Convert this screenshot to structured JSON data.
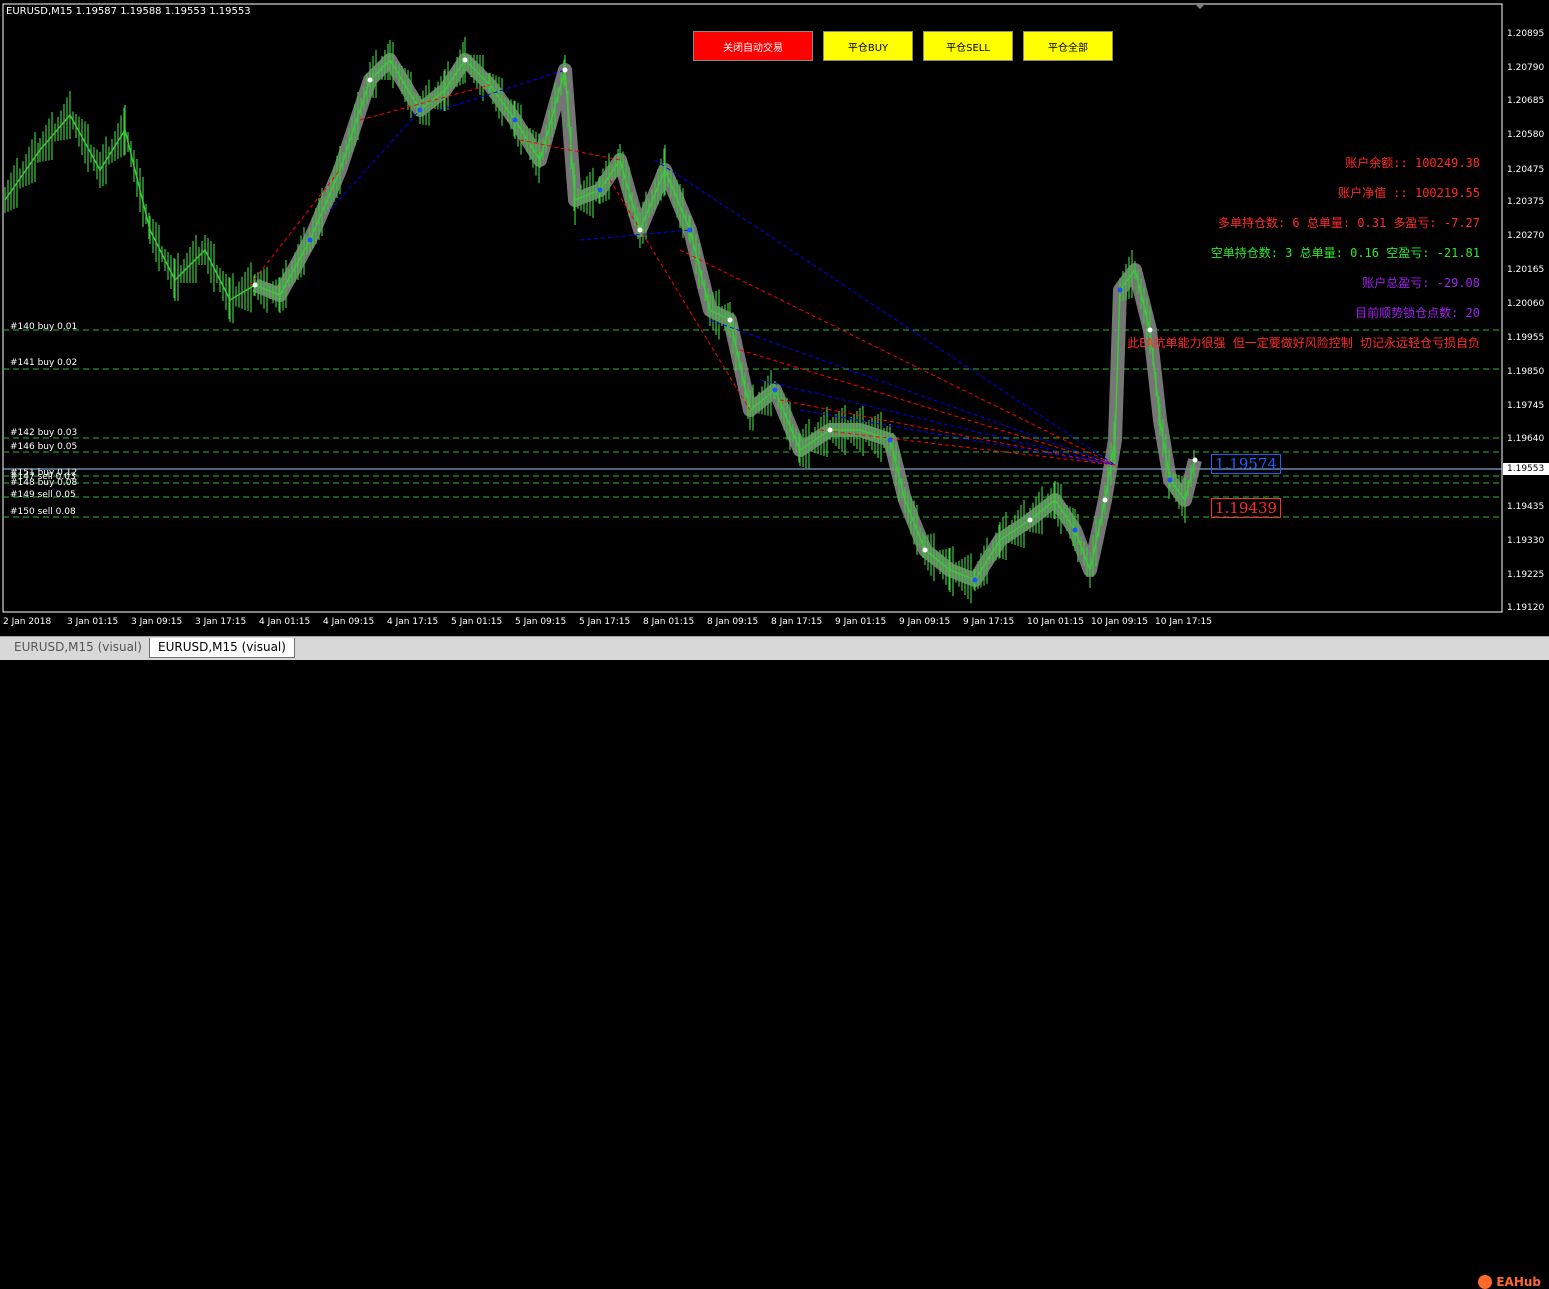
{
  "chart": {
    "title": "EURUSD,M15  1.19587 1.19588 1.19553 1.19553",
    "colors": {
      "background": "#000000",
      "candle": "#3cc83c",
      "grid_line": "#2eb82e",
      "buy_line": "#0000ff",
      "sell_line": "#ff0000"
    },
    "price_axis": {
      "ticks": [
        "1.20895",
        "1.20790",
        "1.20685",
        "1.20580",
        "1.20475",
        "1.20375",
        "1.20270",
        "1.20165",
        "1.20060",
        "1.19955",
        "1.19850",
        "1.19745",
        "1.19640",
        "1.19435",
        "1.19330",
        "1.19225",
        "1.19120"
      ],
      "current_price": "1.19553"
    },
    "date_axis": {
      "ticks": [
        "2 Jan 2018",
        "3 Jan 01:15",
        "3 Jan 09:15",
        "3 Jan 17:15",
        "4 Jan 01:15",
        "4 Jan 09:15",
        "4 Jan 17:15",
        "5 Jan 01:15",
        "5 Jan 09:15",
        "5 Jan 17:15",
        "8 Jan 01:15",
        "8 Jan 09:15",
        "8 Jan 17:15",
        "9 Jan 01:15",
        "9 Jan 09:15",
        "9 Jan 17:15",
        "10 Jan 01:15",
        "10 Jan 09:15",
        "10 Jan 17:15"
      ]
    }
  },
  "controls": {
    "stop_auto_trade": "关闭自动交易",
    "close_buy": "平仓BUY",
    "close_sell": "平仓SELL",
    "close_all": "平仓全部"
  },
  "account": {
    "balance": "账户余额:: 100249.38",
    "equity": "账户净值 :: 100219.55",
    "long_summary": "多单持仓数: 6 总单量: 0.31 多盈亏: -7.27",
    "short_summary": "空单持仓数: 3 总单量: 0.16 空盈亏: -21.81",
    "total_pnl": "账户总盈亏: -29.08",
    "lock_points": "目前顺势锁仓点数: 20",
    "warning": "此EA抗单能力很强 但一定要做好风险控制 切记永远轻仓亏损自负"
  },
  "positions": [
    {
      "label": "#140 buy 0.01"
    },
    {
      "label": "#141 buy 0.02"
    },
    {
      "label": "#142 buy 0.03"
    },
    {
      "label": "#146 buy 0.05"
    },
    {
      "label": "#151 buy 0.12"
    },
    {
      "label": "#147 sell 0.03"
    },
    {
      "label": "#148 buy 0.08"
    },
    {
      "label": "#149 sell 0.05"
    },
    {
      "label": "#150 sell 0.08"
    }
  ],
  "price_markers": {
    "blue": "1.19574",
    "red": "1.19439"
  },
  "tabs": [
    {
      "label": "EURUSD,M15 (visual)",
      "active": false
    },
    {
      "label": "EURUSD,M15 (visual)",
      "active": true
    }
  ],
  "watermark": {
    "text": "EAHub"
  }
}
